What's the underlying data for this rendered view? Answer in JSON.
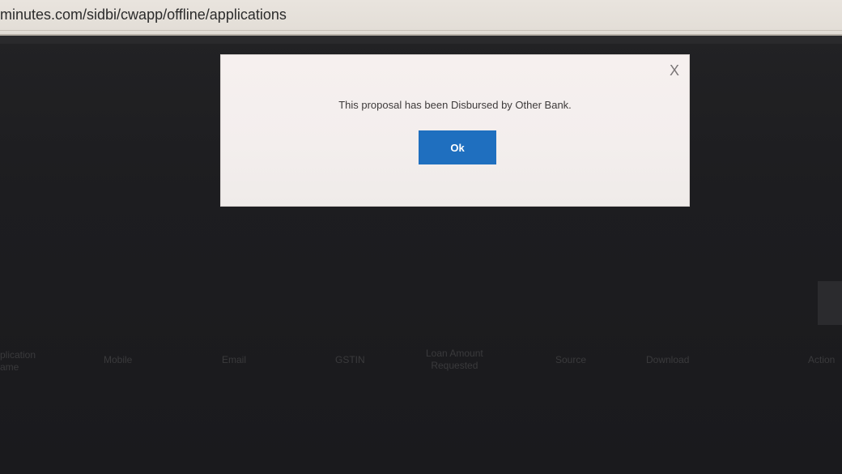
{
  "browser": {
    "url": "minutes.com/sidbi/cwapp/offline/applications"
  },
  "modal": {
    "close_label": "X",
    "message": "This proposal has been Disbursed by Other Bank.",
    "ok_label": "Ok"
  },
  "table": {
    "columns": [
      {
        "label_line1": "plication",
        "label_line2": "ame"
      },
      {
        "label_line1": "Mobile",
        "label_line2": ""
      },
      {
        "label_line1": "Email",
        "label_line2": ""
      },
      {
        "label_line1": "GSTIN",
        "label_line2": ""
      },
      {
        "label_line1": "Loan Amount",
        "label_line2": "Requested"
      },
      {
        "label_line1": "Source",
        "label_line2": ""
      },
      {
        "label_line1": "Download",
        "label_line2": ""
      },
      {
        "label_line1": "Action",
        "label_line2": ""
      }
    ]
  },
  "colors": {
    "primary_button": "#1f6fbf",
    "overlay_background": "#1c1c1e",
    "modal_background": "#f4efee"
  }
}
